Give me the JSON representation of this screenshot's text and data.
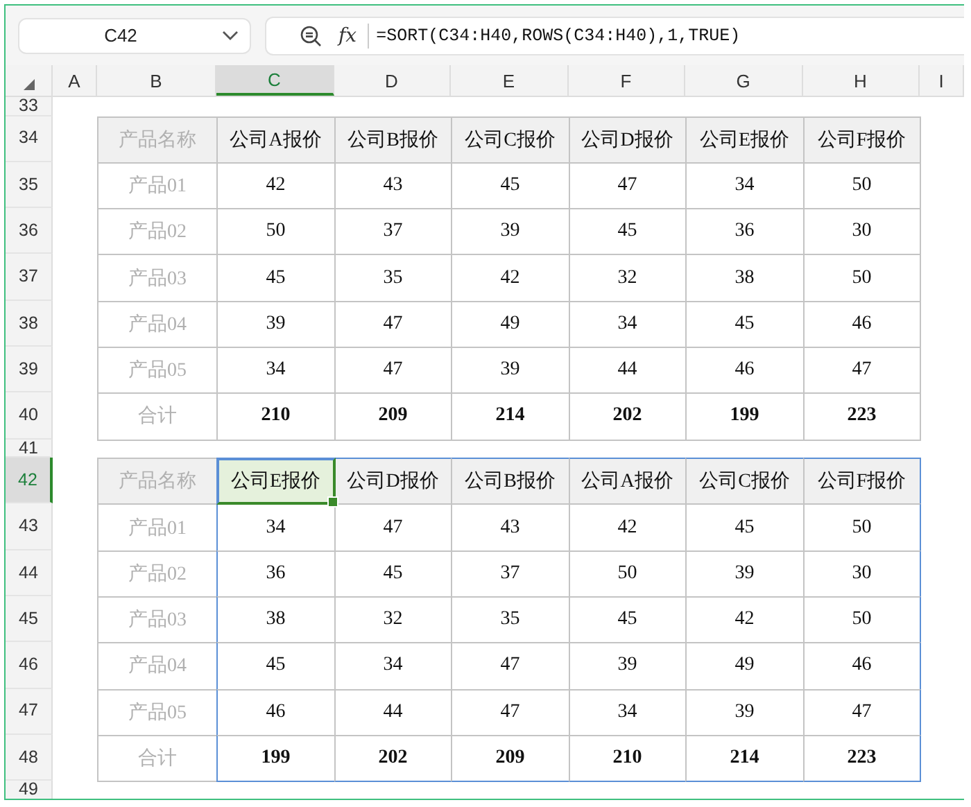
{
  "name_box": {
    "value": "C42"
  },
  "formula_bar": {
    "function_label": "fx",
    "formula": "=SORT(C34:H40,ROWS(C34:H40),1,TRUE)"
  },
  "column_headers": [
    {
      "label": "A",
      "selected": false
    },
    {
      "label": "B",
      "selected": false
    },
    {
      "label": "C",
      "selected": true
    },
    {
      "label": "D",
      "selected": false
    },
    {
      "label": "E",
      "selected": false
    },
    {
      "label": "F",
      "selected": false
    },
    {
      "label": "G",
      "selected": false
    },
    {
      "label": "H",
      "selected": false
    },
    {
      "label": "I",
      "selected": false
    }
  ],
  "sheet_rows": [
    {
      "number": "33",
      "selected": false,
      "kind": "blank"
    },
    {
      "number": "34",
      "selected": false,
      "kind": "header",
      "spill": false,
      "cells": [
        {
          "text": "产品名称",
          "selected": false
        },
        {
          "text": "公司A报价",
          "selected": false
        },
        {
          "text": "公司B报价",
          "selected": false
        },
        {
          "text": "公司C报价",
          "selected": false
        },
        {
          "text": "公司D报价",
          "selected": false
        },
        {
          "text": "公司E报价",
          "selected": false
        },
        {
          "text": "公司F报价",
          "selected": false
        }
      ]
    },
    {
      "number": "35",
      "selected": false,
      "kind": "data",
      "spill": false,
      "cells": [
        {
          "text": "产品01",
          "selected": false
        },
        {
          "text": "42",
          "selected": false
        },
        {
          "text": "43",
          "selected": false
        },
        {
          "text": "45",
          "selected": false
        },
        {
          "text": "47",
          "selected": false
        },
        {
          "text": "34",
          "selected": false
        },
        {
          "text": "50",
          "selected": false
        }
      ]
    },
    {
      "number": "36",
      "selected": false,
      "kind": "data",
      "spill": false,
      "cells": [
        {
          "text": "产品02",
          "selected": false
        },
        {
          "text": "50",
          "selected": false
        },
        {
          "text": "37",
          "selected": false
        },
        {
          "text": "39",
          "selected": false
        },
        {
          "text": "45",
          "selected": false
        },
        {
          "text": "36",
          "selected": false
        },
        {
          "text": "30",
          "selected": false
        }
      ]
    },
    {
      "number": "37",
      "selected": false,
      "kind": "data",
      "spill": false,
      "cells": [
        {
          "text": "产品03",
          "selected": false
        },
        {
          "text": "45",
          "selected": false
        },
        {
          "text": "35",
          "selected": false
        },
        {
          "text": "42",
          "selected": false
        },
        {
          "text": "32",
          "selected": false
        },
        {
          "text": "38",
          "selected": false
        },
        {
          "text": "50",
          "selected": false
        }
      ]
    },
    {
      "number": "38",
      "selected": false,
      "kind": "data",
      "spill": false,
      "cells": [
        {
          "text": "产品04",
          "selected": false
        },
        {
          "text": "39",
          "selected": false
        },
        {
          "text": "47",
          "selected": false
        },
        {
          "text": "49",
          "selected": false
        },
        {
          "text": "34",
          "selected": false
        },
        {
          "text": "45",
          "selected": false
        },
        {
          "text": "46",
          "selected": false
        }
      ]
    },
    {
      "number": "39",
      "selected": false,
      "kind": "data",
      "spill": false,
      "cells": [
        {
          "text": "产品05",
          "selected": false
        },
        {
          "text": "34",
          "selected": false
        },
        {
          "text": "47",
          "selected": false
        },
        {
          "text": "39",
          "selected": false
        },
        {
          "text": "44",
          "selected": false
        },
        {
          "text": "46",
          "selected": false
        },
        {
          "text": "47",
          "selected": false
        }
      ]
    },
    {
      "number": "40",
      "selected": false,
      "kind": "total",
      "spill": false,
      "cells": [
        {
          "text": "合计",
          "selected": false
        },
        {
          "text": "210",
          "selected": false
        },
        {
          "text": "209",
          "selected": false
        },
        {
          "text": "214",
          "selected": false
        },
        {
          "text": "202",
          "selected": false
        },
        {
          "text": "199",
          "selected": false
        },
        {
          "text": "223",
          "selected": false
        }
      ]
    },
    {
      "number": "41",
      "selected": false,
      "kind": "blank"
    },
    {
      "number": "42",
      "selected": true,
      "kind": "header",
      "spill": true,
      "cells": [
        {
          "text": "产品名称",
          "selected": false
        },
        {
          "text": "公司E报价",
          "selected": true
        },
        {
          "text": "公司D报价",
          "selected": false
        },
        {
          "text": "公司B报价",
          "selected": false
        },
        {
          "text": "公司A报价",
          "selected": false
        },
        {
          "text": "公司C报价",
          "selected": false
        },
        {
          "text": "公司F报价",
          "selected": false
        }
      ]
    },
    {
      "number": "43",
      "selected": false,
      "kind": "data",
      "spill": true,
      "cells": [
        {
          "text": "产品01",
          "selected": false
        },
        {
          "text": "34",
          "selected": false
        },
        {
          "text": "47",
          "selected": false
        },
        {
          "text": "43",
          "selected": false
        },
        {
          "text": "42",
          "selected": false
        },
        {
          "text": "45",
          "selected": false
        },
        {
          "text": "50",
          "selected": false
        }
      ]
    },
    {
      "number": "44",
      "selected": false,
      "kind": "data",
      "spill": true,
      "cells": [
        {
          "text": "产品02",
          "selected": false
        },
        {
          "text": "36",
          "selected": false
        },
        {
          "text": "45",
          "selected": false
        },
        {
          "text": "37",
          "selected": false
        },
        {
          "text": "50",
          "selected": false
        },
        {
          "text": "39",
          "selected": false
        },
        {
          "text": "30",
          "selected": false
        }
      ]
    },
    {
      "number": "45",
      "selected": false,
      "kind": "data",
      "spill": true,
      "cells": [
        {
          "text": "产品03",
          "selected": false
        },
        {
          "text": "38",
          "selected": false
        },
        {
          "text": "32",
          "selected": false
        },
        {
          "text": "35",
          "selected": false
        },
        {
          "text": "45",
          "selected": false
        },
        {
          "text": "42",
          "selected": false
        },
        {
          "text": "50",
          "selected": false
        }
      ]
    },
    {
      "number": "46",
      "selected": false,
      "kind": "data",
      "spill": true,
      "cells": [
        {
          "text": "产品04",
          "selected": false
        },
        {
          "text": "45",
          "selected": false
        },
        {
          "text": "34",
          "selected": false
        },
        {
          "text": "47",
          "selected": false
        },
        {
          "text": "39",
          "selected": false
        },
        {
          "text": "49",
          "selected": false
        },
        {
          "text": "46",
          "selected": false
        }
      ]
    },
    {
      "number": "47",
      "selected": false,
      "kind": "data",
      "spill": true,
      "cells": [
        {
          "text": "产品05",
          "selected": false
        },
        {
          "text": "46",
          "selected": false
        },
        {
          "text": "44",
          "selected": false
        },
        {
          "text": "47",
          "selected": false
        },
        {
          "text": "34",
          "selected": false
        },
        {
          "text": "39",
          "selected": false
        },
        {
          "text": "47",
          "selected": false
        }
      ]
    },
    {
      "number": "48",
      "selected": false,
      "kind": "total",
      "spill": true,
      "cells": [
        {
          "text": "合计",
          "selected": false
        },
        {
          "text": "199",
          "selected": false
        },
        {
          "text": "202",
          "selected": false
        },
        {
          "text": "209",
          "selected": false
        },
        {
          "text": "210",
          "selected": false
        },
        {
          "text": "214",
          "selected": false
        },
        {
          "text": "223",
          "selected": false
        }
      ]
    },
    {
      "number": "49",
      "selected": false,
      "kind": "blank"
    }
  ]
}
